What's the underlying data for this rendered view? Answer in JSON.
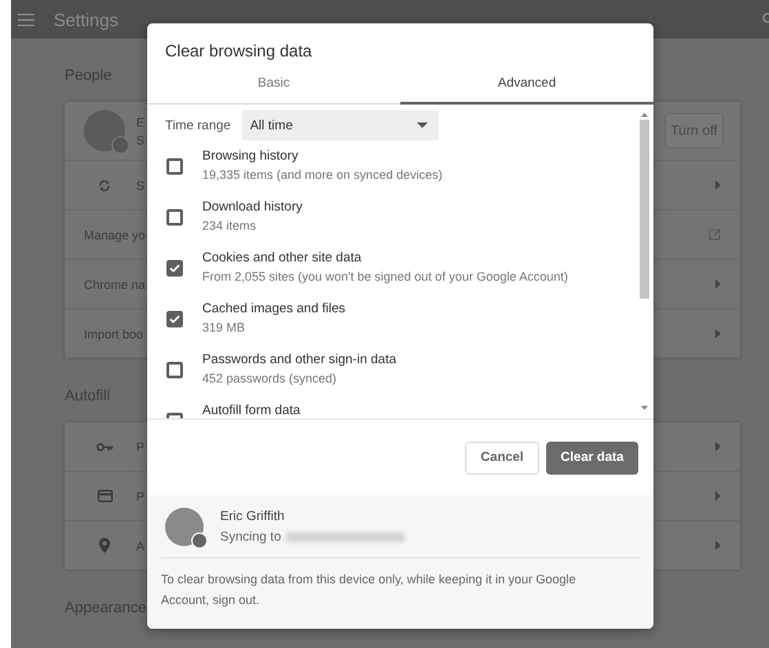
{
  "app_bar": {
    "title": "Settings"
  },
  "sections": [
    {
      "heading": "People",
      "rows": [
        {
          "kind": "account",
          "line_1": "E",
          "line_2": "S",
          "button": "Turn off"
        },
        {
          "kind": "sync",
          "label": "S"
        },
        {
          "kind": "external",
          "label": "Manage yo"
        },
        {
          "kind": "link",
          "label": "Chrome na"
        },
        {
          "kind": "link",
          "label": "Import boo"
        }
      ]
    },
    {
      "heading": "Autofill",
      "rows": [
        {
          "kind": "key",
          "label": "P"
        },
        {
          "kind": "card",
          "label": "P"
        },
        {
          "kind": "pin",
          "label": "A"
        }
      ]
    },
    {
      "heading": "Appearance"
    }
  ],
  "dialog": {
    "title": "Clear browsing data",
    "tabs": [
      {
        "label": "Basic",
        "selected": false
      },
      {
        "label": "Advanced",
        "selected": true
      }
    ],
    "time_range": {
      "label": "Time range",
      "value": "All time"
    },
    "items": [
      {
        "title": "Browsing history",
        "detail": "19,335 items (and more on synced devices)",
        "checked": false
      },
      {
        "title": "Download history",
        "detail": "234 items",
        "checked": false
      },
      {
        "title": "Cookies and other site data",
        "detail": "From 2,055 sites (you won't be signed out of your Google Account)",
        "checked": true
      },
      {
        "title": "Cached images and files",
        "detail": "319 MB",
        "checked": true
      },
      {
        "title": "Passwords and other sign-in data",
        "detail": "452 passwords (synced)",
        "checked": false
      },
      {
        "title": "Autofill form data",
        "checked": false
      }
    ],
    "buttons": {
      "cancel": "Cancel",
      "confirm": "Clear data"
    },
    "account": {
      "name": "Eric Griffith",
      "sync_label": "Syncing to"
    },
    "note": "To clear browsing data from this device only, while keeping it in your Google Account, sign out."
  }
}
